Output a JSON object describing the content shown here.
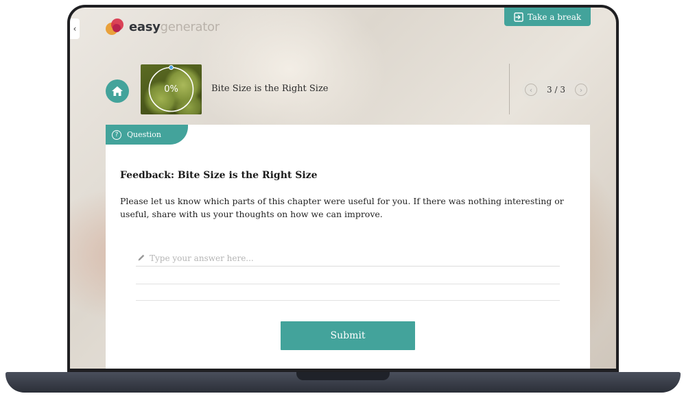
{
  "header": {
    "back_glyph": "‹",
    "logo": {
      "part1": "easy",
      "part2": "generator"
    },
    "take_break_label": "Take a break",
    "take_break_icon": "exit-icon",
    "home_icon": "home-icon",
    "progress_percent": "0%",
    "progress_value": 0,
    "chapter_title": "Bite Size is the Right Size",
    "pager": {
      "text": "3 / 3",
      "prev_icon": "chevron-left-icon",
      "next_icon": "chevron-right-icon"
    }
  },
  "question": {
    "tab_label": "Question",
    "title": "Feedback: Bite Size is the Right Size",
    "text": "Please let us know which parts of this chapter were useful for you. If there was nothing interesting or useful, share with us your thoughts on how we can improve.",
    "answer_placeholder": "Type your answer here...",
    "answer_value": "",
    "submit_label": "Submit"
  },
  "colors": {
    "accent": "#43a39b",
    "frame": "#1f1f22",
    "logo_orange": "#e9a13b",
    "logo_red": "#d8354b"
  }
}
